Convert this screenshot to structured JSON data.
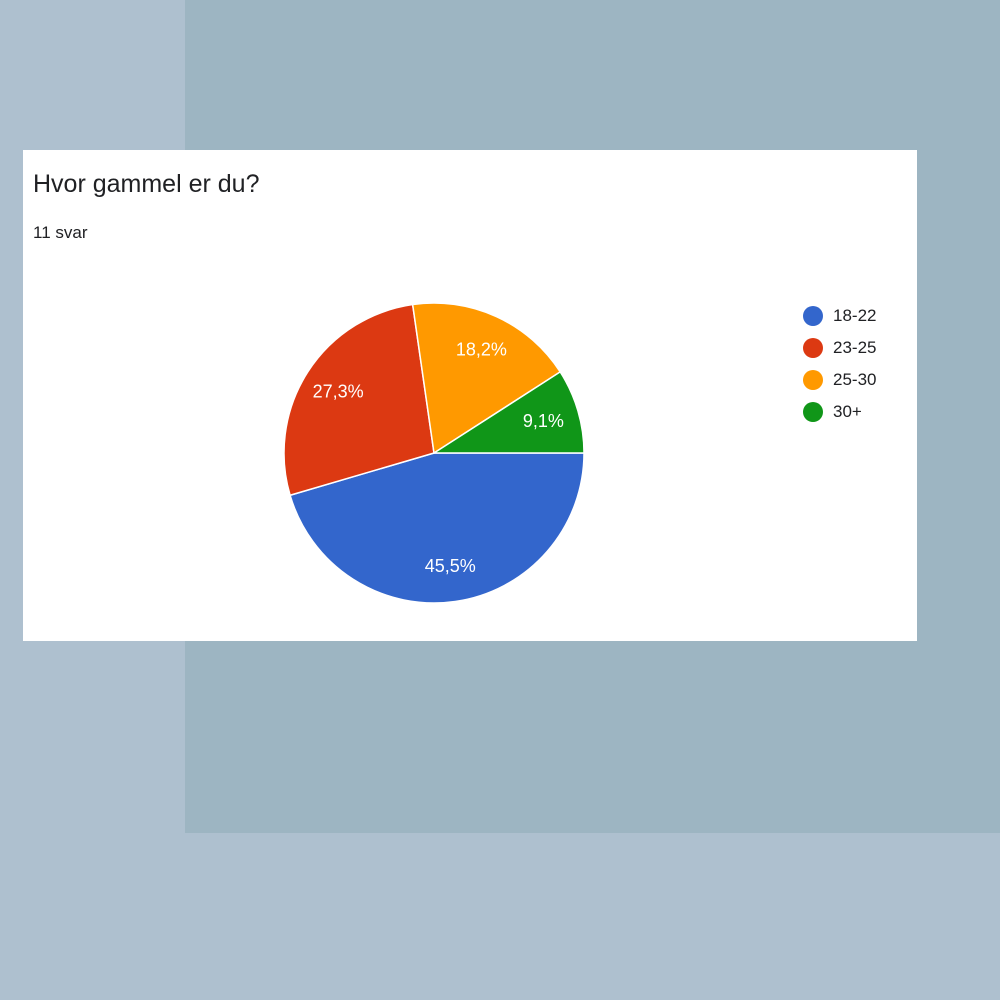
{
  "chart_data": {
    "type": "pie",
    "title": "Hvor gammel er du?",
    "subtitle": "11 svar",
    "categories": [
      "18-22",
      "23-25",
      "25-30",
      "30+"
    ],
    "values": [
      45.5,
      27.3,
      18.2,
      9.1
    ],
    "labels": [
      "45,5%",
      "27,3%",
      "18,2%",
      "9,1%"
    ],
    "colors": [
      "#3366cc",
      "#dc3912",
      "#ff9900",
      "#109618"
    ],
    "legend_position": "right",
    "start": "3 o'clock, clockwise"
  }
}
